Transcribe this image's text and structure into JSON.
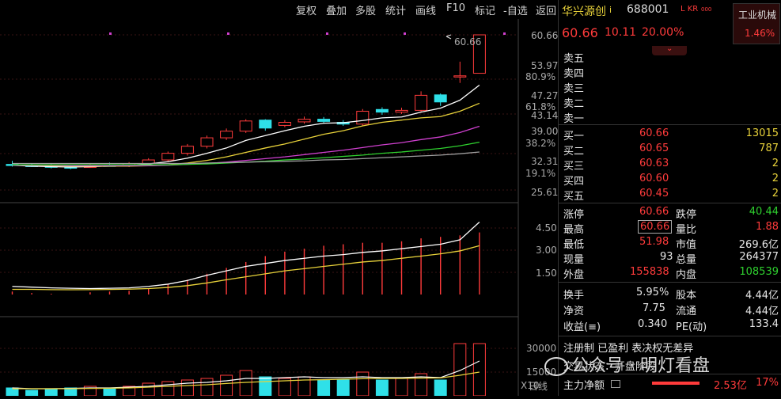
{
  "toolbar": {
    "items": [
      "复权",
      "叠加",
      "多股",
      "统计",
      "画线",
      "F10",
      "标记",
      "-自选",
      "返回"
    ]
  },
  "header": {
    "name": "华兴源创",
    "flag": "i",
    "code": "688001",
    "tags": "L KR",
    "tag_num": "000",
    "price": "60.66",
    "change": "10.11",
    "change_pct": "20.00%",
    "industry": "工业机械",
    "industry_pct": "1.46%"
  },
  "sell_levels": [
    "卖五",
    "卖四",
    "卖三",
    "卖二",
    "卖一"
  ],
  "buy_levels": [
    {
      "label": "买一",
      "price": "60.66",
      "vol": "13015"
    },
    {
      "label": "买二",
      "price": "60.65",
      "vol": "787"
    },
    {
      "label": "买三",
      "price": "60.63",
      "vol": "2"
    },
    {
      "label": "买四",
      "price": "60.60",
      "vol": "2"
    },
    {
      "label": "买五",
      "price": "60.45",
      "vol": "2"
    }
  ],
  "stats": [
    {
      "l1": "涨停",
      "v1": "60.66",
      "l2": "跌停",
      "v2": "40.44"
    },
    {
      "l1": "最高",
      "v1": "60.66",
      "l2": "量比",
      "v2": "1.88"
    },
    {
      "l1": "最低",
      "v1": "51.98",
      "l2": "市值",
      "v2": "269.6亿"
    },
    {
      "l1": "现量",
      "v1": "93",
      "l2": "总量",
      "v2": "264377"
    },
    {
      "l1": "外盘",
      "v1": "155838",
      "l2": "内盘",
      "v2": "108539"
    }
  ],
  "stats2": [
    {
      "l1": "换手",
      "v1": "5.95%",
      "l2": "股本",
      "v2": "4.44亿"
    },
    {
      "l1": "净资",
      "v1": "7.75",
      "l2": "流通",
      "v2": "4.44亿"
    },
    {
      "l1": "收益(≡)",
      "v1": "0.340",
      "l2": "PE(动)",
      "v2": "133.4"
    }
  ],
  "tags_line": "注册制 已盈利 表决权无差异",
  "trade_line": "交易状态：开盘阶段",
  "watermark": "公众号 · 明灯看盘",
  "main_flow": {
    "label": "主力净额",
    "value": "2.53亿",
    "pct": "17%"
  },
  "chart_labels": {
    "price_ticks": [
      "60.66",
      "53.97",
      "47.27",
      "43.14",
      "39.00",
      "32.31",
      "25.61"
    ],
    "pct_ticks": [
      "80.9%",
      "61.8%",
      "38.2%",
      "19.1%"
    ],
    "mid_ticks": [
      "4.50",
      "3.00",
      "1.50"
    ],
    "vol_ticks": [
      "30000",
      "15000"
    ],
    "vol_unit": "X10",
    "period": "日线",
    "last_price": "60.66"
  },
  "colors": {
    "up": "#ff3b3b",
    "down": "#2fe0e8",
    "ma1": "#ffffff",
    "ma2": "#e8d23a",
    "ma3": "#d040d0",
    "ma4": "#2fd12f",
    "ma5": "#a0a0a0"
  },
  "chart_data": {
    "type": "candlestick",
    "candles": [
      {
        "o": 31.4,
        "h": 32.2,
        "l": 30.9,
        "c": 31.2
      },
      {
        "o": 31.2,
        "h": 31.6,
        "l": 30.8,
        "c": 30.9
      },
      {
        "o": 31.0,
        "h": 31.5,
        "l": 30.5,
        "c": 30.8
      },
      {
        "o": 30.8,
        "h": 31.3,
        "l": 30.3,
        "c": 30.7
      },
      {
        "o": 30.7,
        "h": 31.6,
        "l": 30.6,
        "c": 31.2
      },
      {
        "o": 31.2,
        "h": 31.8,
        "l": 30.9,
        "c": 31.1
      },
      {
        "o": 31.1,
        "h": 31.9,
        "l": 30.8,
        "c": 31.6
      },
      {
        "o": 31.6,
        "h": 32.8,
        "l": 31.3,
        "c": 32.4
      },
      {
        "o": 32.4,
        "h": 34.3,
        "l": 32.0,
        "c": 33.9
      },
      {
        "o": 33.9,
        "h": 36.0,
        "l": 33.4,
        "c": 35.5
      },
      {
        "o": 35.5,
        "h": 37.9,
        "l": 35.0,
        "c": 37.4
      },
      {
        "o": 37.4,
        "h": 39.5,
        "l": 36.9,
        "c": 38.9
      },
      {
        "o": 38.9,
        "h": 41.6,
        "l": 38.5,
        "c": 41.2
      },
      {
        "o": 41.4,
        "h": 41.6,
        "l": 39.0,
        "c": 39.6
      },
      {
        "o": 40.2,
        "h": 41.4,
        "l": 39.8,
        "c": 40.9
      },
      {
        "o": 41.0,
        "h": 42.2,
        "l": 40.6,
        "c": 41.6
      },
      {
        "o": 41.6,
        "h": 42.1,
        "l": 40.6,
        "c": 41.1
      },
      {
        "o": 40.9,
        "h": 41.4,
        "l": 40.1,
        "c": 40.5
      },
      {
        "o": 40.5,
        "h": 43.9,
        "l": 40.0,
        "c": 43.4
      },
      {
        "o": 43.8,
        "h": 44.3,
        "l": 42.6,
        "c": 43.2
      },
      {
        "o": 43.2,
        "h": 44.2,
        "l": 42.8,
        "c": 43.6
      },
      {
        "o": 43.6,
        "h": 47.9,
        "l": 43.1,
        "c": 47.0
      },
      {
        "o": 47.1,
        "h": 47.4,
        "l": 44.6,
        "c": 45.5
      },
      {
        "o": 51.2,
        "h": 54.6,
        "l": 49.8,
        "c": 51.4
      },
      {
        "o": 51.98,
        "h": 60.66,
        "l": 51.98,
        "c": 60.66
      }
    ],
    "ma": [
      {
        "name": "ma5",
        "values": [
          31.2,
          31.0,
          30.9,
          30.8,
          30.9,
          31.0,
          31.2,
          31.5,
          32.0,
          32.8,
          33.9,
          35.1,
          36.8,
          37.9,
          39.0,
          40.0,
          40.7,
          40.8,
          41.3,
          41.9,
          42.1,
          43.2,
          44.1,
          45.9,
          49.3
        ]
      },
      {
        "name": "ma10",
        "values": [
          31.3,
          31.2,
          31.1,
          31.0,
          31.0,
          31.0,
          31.0,
          31.1,
          31.3,
          31.7,
          32.3,
          33.1,
          34.1,
          35.1,
          36.0,
          37.1,
          38.2,
          39.0,
          40.1,
          40.9,
          41.4,
          41.9,
          42.2,
          43.4,
          45.2
        ]
      },
      {
        "name": "ma20",
        "values": [
          31.2,
          31.2,
          31.2,
          31.1,
          31.1,
          31.1,
          31.1,
          31.1,
          31.2,
          31.4,
          31.6,
          31.9,
          32.3,
          32.7,
          33.1,
          33.6,
          34.1,
          34.6,
          35.2,
          35.8,
          36.3,
          37.0,
          37.6,
          38.6,
          40.0
        ]
      },
      {
        "name": "ma30",
        "values": [
          31.3,
          31.3,
          31.3,
          31.3,
          31.3,
          31.3,
          31.3,
          31.3,
          31.3,
          31.4,
          31.5,
          31.7,
          31.9,
          32.1,
          32.4,
          32.6,
          32.9,
          33.2,
          33.5,
          33.9,
          34.2,
          34.6,
          35.0,
          35.6,
          36.4
        ]
      },
      {
        "name": "ma60",
        "values": [
          31.6,
          31.6,
          31.6,
          31.6,
          31.6,
          31.6,
          31.6,
          31.6,
          31.6,
          31.6,
          31.7,
          31.8,
          31.9,
          32.0,
          32.1,
          32.2,
          32.4,
          32.5,
          32.7,
          32.9,
          33.1,
          33.3,
          33.5,
          33.8,
          34.2
        ]
      }
    ],
    "ind_bars": [
      0.2,
      0.1,
      0.05,
      0.0,
      0.15,
      0.2,
      0.25,
      0.4,
      0.7,
      1.0,
      1.4,
      1.8,
      2.2,
      2.6,
      2.9,
      3.1,
      3.3,
      3.4,
      3.5,
      3.5,
      3.6,
      3.8,
      3.9,
      4.0,
      4.2
    ],
    "ind_line1": [
      0.55,
      0.5,
      0.45,
      0.42,
      0.4,
      0.42,
      0.45,
      0.55,
      0.7,
      0.95,
      1.3,
      1.6,
      1.9,
      2.1,
      2.3,
      2.45,
      2.6,
      2.7,
      2.85,
      2.95,
      3.1,
      3.25,
      3.4,
      3.7,
      4.9
    ],
    "ind_line2": [
      0.35,
      0.35,
      0.33,
      0.32,
      0.33,
      0.34,
      0.36,
      0.4,
      0.48,
      0.6,
      0.78,
      1.0,
      1.2,
      1.4,
      1.6,
      1.75,
      1.9,
      2.05,
      2.2,
      2.3,
      2.45,
      2.6,
      2.75,
      2.95,
      3.3
    ],
    "volume": [
      0.5,
      0.35,
      0.4,
      0.5,
      0.6,
      0.5,
      0.6,
      0.8,
      0.9,
      1.0,
      1.1,
      1.3,
      1.6,
      1.2,
      1.1,
      1.2,
      1.0,
      1.0,
      1.5,
      1.0,
      1.1,
      1.4,
      1.0,
      3.3,
      3.3
    ],
    "vol_ma1": [
      0.5,
      0.45,
      0.45,
      0.47,
      0.5,
      0.5,
      0.55,
      0.6,
      0.7,
      0.8,
      0.85,
      0.95,
      1.1,
      1.1,
      1.15,
      1.2,
      1.15,
      1.15,
      1.2,
      1.15,
      1.15,
      1.2,
      1.15,
      1.6,
      2.2
    ],
    "vol_ma2": [
      0.45,
      0.45,
      0.45,
      0.45,
      0.47,
      0.48,
      0.5,
      0.55,
      0.6,
      0.65,
      0.7,
      0.78,
      0.85,
      0.9,
      0.95,
      1.0,
      1.02,
      1.05,
      1.08,
      1.1,
      1.1,
      1.12,
      1.13,
      1.3,
      1.5
    ]
  }
}
